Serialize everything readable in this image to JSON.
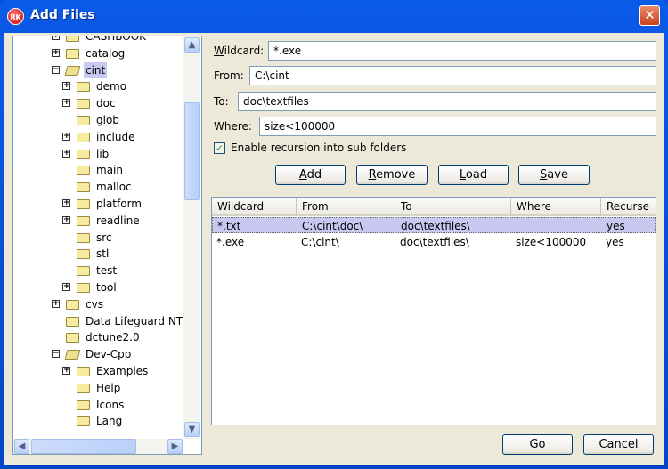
{
  "window": {
    "title": "Add Files",
    "logo_text": "RK",
    "close_icon": "close-icon"
  },
  "tree": {
    "items": [
      {
        "label": "CASHBOOK",
        "level": 1,
        "expander": "plus",
        "open": false
      },
      {
        "label": "catalog",
        "level": 1,
        "expander": "plus",
        "open": false
      },
      {
        "label": "cint",
        "level": 1,
        "expander": "minus",
        "open": true,
        "selected": true
      },
      {
        "label": "demo",
        "level": 2,
        "expander": "plus"
      },
      {
        "label": "doc",
        "level": 2,
        "expander": "plus"
      },
      {
        "label": "glob",
        "level": 2,
        "expander": "none"
      },
      {
        "label": "include",
        "level": 2,
        "expander": "plus"
      },
      {
        "label": "lib",
        "level": 2,
        "expander": "plus"
      },
      {
        "label": "main",
        "level": 2,
        "expander": "none"
      },
      {
        "label": "malloc",
        "level": 2,
        "expander": "none"
      },
      {
        "label": "platform",
        "level": 2,
        "expander": "plus"
      },
      {
        "label": "readline",
        "level": 2,
        "expander": "plus"
      },
      {
        "label": "src",
        "level": 2,
        "expander": "none"
      },
      {
        "label": "stl",
        "level": 2,
        "expander": "none"
      },
      {
        "label": "test",
        "level": 2,
        "expander": "none"
      },
      {
        "label": "tool",
        "level": 2,
        "expander": "plus"
      },
      {
        "label": "cvs",
        "level": 1,
        "expander": "plus"
      },
      {
        "label": "Data Lifeguard NT",
        "level": 1,
        "expander": "none"
      },
      {
        "label": "dctune2.0",
        "level": 1,
        "expander": "none"
      },
      {
        "label": "Dev-Cpp",
        "level": 1,
        "expander": "minus",
        "open": true
      },
      {
        "label": "Examples",
        "level": 2,
        "expander": "plus"
      },
      {
        "label": "Help",
        "level": 2,
        "expander": "none"
      },
      {
        "label": "Icons",
        "level": 2,
        "expander": "none"
      },
      {
        "label": "Lang",
        "level": 2,
        "expander": "none"
      }
    ]
  },
  "form": {
    "wildcard_label": "Wildcard:",
    "wildcard_value": "*.exe",
    "from_label": "From:",
    "from_value": "C:\\cint",
    "to_label": "To:",
    "to_value": "doc\\textfiles",
    "where_label": "Where:",
    "where_value": "size<100000",
    "recursion_label": "Enable recursion into sub folders",
    "recursion_checked": true
  },
  "buttons": {
    "add": "Add",
    "remove": "Remove",
    "load": "Load",
    "save": "Save",
    "go": "Go",
    "cancel": "Cancel"
  },
  "table": {
    "columns": [
      "Wildcard",
      "From",
      "To",
      "Where",
      "Recurse"
    ],
    "rows": [
      [
        "*.txt",
        "C:\\cint\\doc\\",
        "doc\\textfiles\\",
        "",
        "yes"
      ],
      [
        "*.exe",
        "C:\\cint\\",
        "doc\\textfiles\\",
        "size<100000",
        "yes"
      ]
    ],
    "selected_row": 0
  }
}
